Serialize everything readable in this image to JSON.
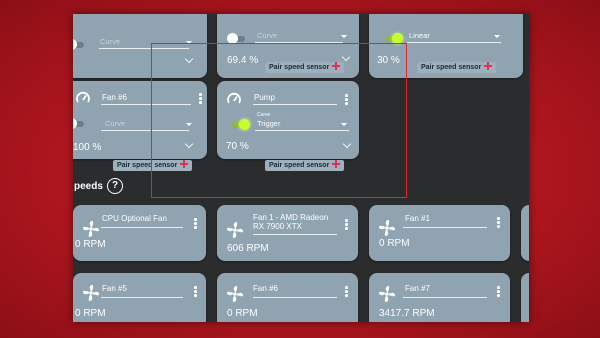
{
  "colors": {
    "accent": "#c6ff2e",
    "card": "#8fa3b0",
    "panel": "#2b2c2e",
    "highlight_box": "#e0262e",
    "pair_plus": "#e0315b"
  },
  "top_row": [
    {
      "mode": "Curve",
      "value": "",
      "pair_label": ""
    },
    {
      "mode": "Curve",
      "value": "69.4 %",
      "pair_label": "Pair speed sensor"
    },
    {
      "mode": "Linear",
      "value": "30 %",
      "pair_label": "Pair speed sensor"
    }
  ],
  "controls": [
    {
      "name": "Fan #6",
      "mode": "Curve",
      "value": "100 %",
      "pair_label": "Pair speed sensor",
      "icon": "gauge-icon"
    },
    {
      "name": "Pump",
      "mode_label": "Curve",
      "mode": "Trigger",
      "value": "70 %",
      "pair_label": "Pair speed sensor",
      "icon": "gauge-icon"
    }
  ],
  "section": {
    "title": "peeds",
    "help_icon": "?"
  },
  "fans_row1": [
    {
      "name": "CPU Optional Fan",
      "rpm": "0 RPM",
      "icon": "fan-icon"
    },
    {
      "name": "Fan 1 - AMD Radeon RX 7900 XTX",
      "rpm": "606 RPM",
      "icon": "fan-icon"
    },
    {
      "name": "Fan #1",
      "rpm": "0 RPM",
      "icon": "fan-icon"
    }
  ],
  "fans_row2": [
    {
      "name": "Fan #5",
      "rpm": "0 RPM",
      "icon": "fan-icon"
    },
    {
      "name": "Fan #6",
      "rpm": "0 RPM",
      "icon": "fan-icon"
    },
    {
      "name": "Fan #7",
      "rpm": "3417.7 RPM",
      "icon": "fan-icon"
    }
  ]
}
